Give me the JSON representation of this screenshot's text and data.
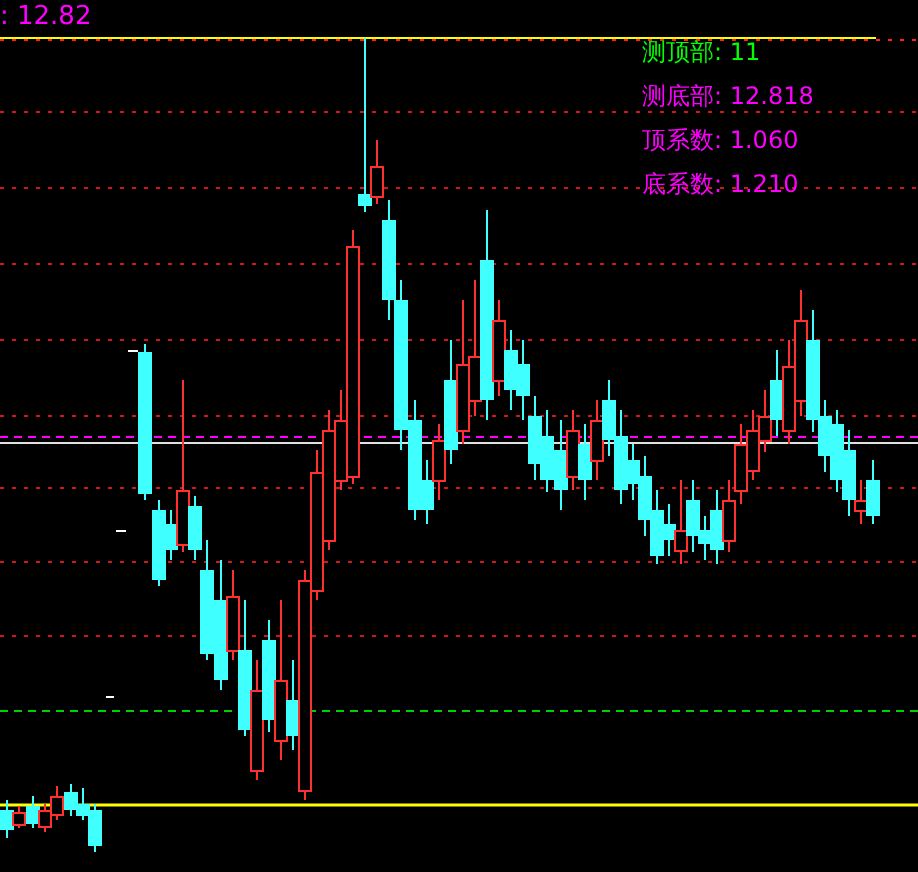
{
  "header": {
    "value_text": ": 12.82"
  },
  "legend": [
    {
      "label": "测顶部:",
      "value": "11",
      "color": "#00ff00"
    },
    {
      "label": "测底部:",
      "value": "12.818",
      "color": "#ff00ff"
    },
    {
      "label": "顶系数:",
      "value": "1.060",
      "color": "#ff00ff"
    },
    {
      "label": "底系数:",
      "value": "1.210",
      "color": "#ff00ff"
    }
  ]
}
